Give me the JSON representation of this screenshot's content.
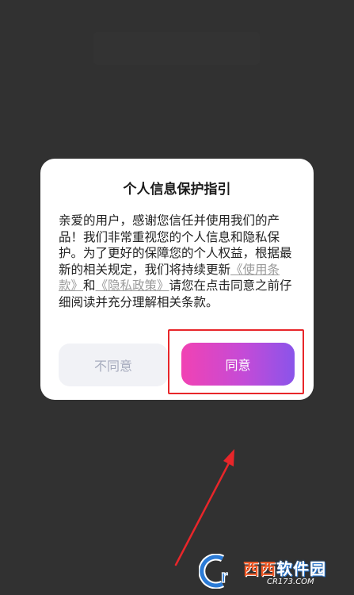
{
  "dialog": {
    "title": "个人信息保护指引",
    "body_part1": "亲爱的用户，感谢您信任并使用我们的产品！我们非常重视您的个人信息和隐私保护。为了更好的保障您的个人权益，根据最新的相关规定，我们将持续更新",
    "terms_link": "《使用条款》",
    "and": "和",
    "privacy_link": "《隐私政策》",
    "body_part2": "请您在点击同意之前仔细阅读并充分理解相关条款。",
    "disagree_label": "不同意",
    "agree_label": "同意"
  },
  "colors": {
    "overlay": "#313131",
    "agree_gradient_start": "#f142b3",
    "agree_gradient_end": "#8a54ea",
    "annotation_red": "#e8262a"
  },
  "watermark": {
    "logo_letters": "Cr",
    "brand_red": "西西",
    "brand_rest": "软件园",
    "url": "CR173.COM"
  }
}
